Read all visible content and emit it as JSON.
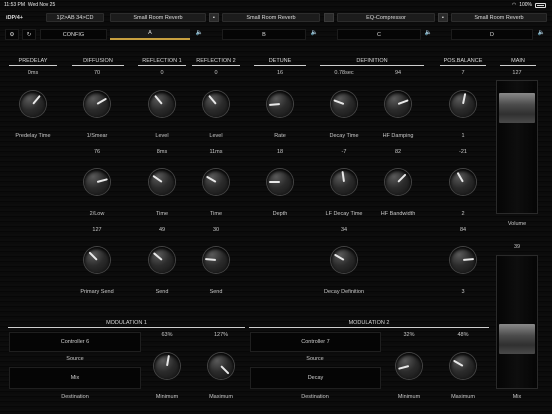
{
  "status": {
    "time": "11:53 PM",
    "date": "Wed Nov 25",
    "battery": "100%"
  },
  "toolbar": {
    "app_title": "iDP/4+",
    "routing": "1|2>AB 34>CD",
    "slot1": "Small Room Reverb",
    "slot2": "Small Room Reverb",
    "slot3": "EQ-Compressor",
    "slot4": "Small Room Reverb",
    "config": "CONFIG",
    "tabs": [
      "A",
      "B",
      "C",
      "D"
    ],
    "accent": "#c8a040"
  },
  "sections": {
    "predelay": "PREDELAY",
    "diffusion": "DIFFUSION",
    "reflection1": "REFLECTION 1",
    "reflection2": "REFLECTION 2",
    "detune": "DETUNE",
    "definition": "DEFINITION",
    "pos_balance": "POS.BALANCE",
    "main": "MAIN",
    "mod1": "MODULATION 1",
    "mod2": "MODULATION 2"
  },
  "row1": {
    "predelay_val": "0ms",
    "predelay_lbl": "Predelay Time",
    "diff_val": "70",
    "diff_lbl": "1/Smear",
    "ref1_val": "0",
    "ref1_lbl": "Level",
    "ref2_val": "0",
    "ref2_lbl": "Level",
    "detune_val": "16",
    "detune_lbl": "Rate",
    "decay_val": "0.78sec",
    "decay_lbl": "Decay Time",
    "hfd_val": "94",
    "hfd_lbl": "HF Damping",
    "pos_val": "7",
    "pos_lbl": "1",
    "main_val": "127",
    "volume_lbl": "Volume"
  },
  "row2": {
    "diff_val": "76",
    "diff_lbl": "2/Low",
    "ref1_val": "8ms",
    "ref1_lbl": "Time",
    "ref2_val": "11ms",
    "ref2_lbl": "Time",
    "detune_val": "18",
    "detune_lbl": "Depth",
    "lfd_val": "-7",
    "lfd_lbl": "LF Decay Time",
    "hfb_val": "82",
    "hfb_lbl": "HF Bandwidth",
    "pos_val": "-21",
    "pos_lbl": "2",
    "mix_val": "39"
  },
  "row3": {
    "diff_val": "127",
    "diff_lbl": "Primary Send",
    "ref1_val": "49",
    "ref1_lbl": "Send",
    "ref2_val": "30",
    "ref2_lbl": "Send",
    "def_val": "34",
    "def_lbl": "Decay Definition",
    "pos_val": "84",
    "pos_lbl": "3",
    "mix_lbl": "Mix"
  },
  "mod1": {
    "source": "Controller 6",
    "source_lbl": "Source",
    "dest": "Mix",
    "dest_lbl": "Destination",
    "min_val": "63%",
    "min_lbl": "Minimum",
    "max_val": "127%",
    "max_lbl": "Maximum"
  },
  "mod2": {
    "source": "Controller 7",
    "source_lbl": "Source",
    "dest": "Decay",
    "dest_lbl": "Destination",
    "min_val": "32%",
    "min_lbl": "Minimum",
    "max_val": "48%",
    "max_lbl": "Maximum"
  }
}
